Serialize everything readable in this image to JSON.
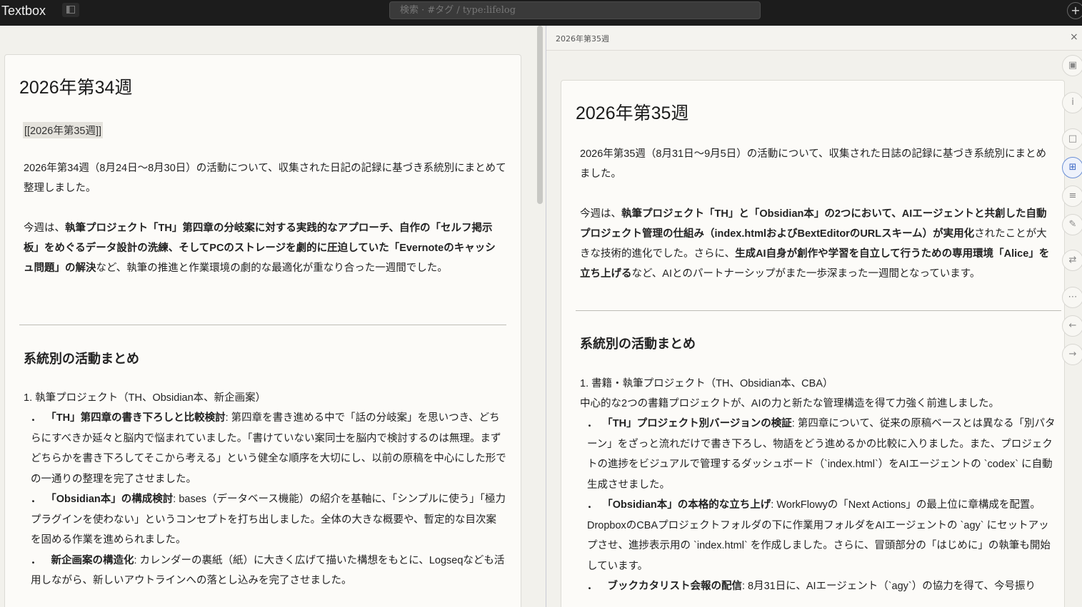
{
  "topbar": {
    "app_title": "Textbox",
    "search_placeholder": "検索 · #タグ / type:lifelog",
    "plus_label": "+"
  },
  "left": {
    "title": "2026年第34週",
    "link": "[[2026年第35週]]",
    "intro": "2026年第34週（8月24日〜8月30日）の活動について、収集された日記の記録に基づき系統別にまとめて整理しました。",
    "summary_prefix": "今週は、",
    "summary_bold": "執筆プロジェクト「TH」第四章の分岐案に対する実践的なアプローチ、自作の「セルフ掲示板」をめぐるデータ設計の洗練、そしてPCのストレージを劇的に圧迫していた「Evernoteのキャッシュ問題」の解決",
    "summary_suffix": "など、執筆の推進と作業環境の劇的な最適化が重なり合った一週間でした。",
    "section": "系統別の活動まとめ",
    "list_heading": "1. 執筆プロジェクト（TH、Obsidian本、新企画案）",
    "items": [
      {
        "bold": "「TH」第四章の書き下ろしと比較検討",
        "text": ": 第四章を書き進める中で「話の分岐案」を思いつき、どちらにすべきか延々と脳内で悩まれていました。「書けていない案同士を脳内で検討するのは無理。まずどちらかを書き下ろしてそこから考える」という健全な順序を大切にし、以前の原稿を中心にした形での一通りの整理を完了させました。"
      },
      {
        "bold": "「Obsidian本」の構成検討",
        "text": ": bases（データベース機能）の紹介を基軸に、「シンプルに使う」「極力プラグインを使わない」というコンセプトを打ち出しました。全体の大きな概要や、暫定的な目次案を固める作業を進められました。"
      },
      {
        "bold": "新企画案の構造化",
        "text": ": カレンダーの裏紙（紙）に大きく広げて描いた構想をもとに、Logseqなども活用しながら、新しいアウトラインへの落とし込みを完了させました。"
      }
    ]
  },
  "right": {
    "tab_label": "2026年第35週",
    "close_label": "×",
    "title": "2026年第35週",
    "intro": "2026年第35週（8月31日〜9月5日）の活動について、収集された日誌の記録に基づき系統別にまとめました。",
    "summary_prefix": "今週は、",
    "summary_bold1": "執筆プロジェクト「TH」と「Obsidian本」の2つにおいて、AIエージェントと共創した自動プロジェクト管理の仕組み（index.htmlおよびBextEditorのURLスキーム）が実用化",
    "summary_mid": "されたことが大きな技術的進化でした。さらに、",
    "summary_bold2": "生成AI自身が創作や学習を自立して行うための専用環境「Alice」を立ち上げる",
    "summary_suffix": "など、AIとのパートナーシップがまた一歩深まった一週間となっています。",
    "section": "系統別の活動まとめ",
    "list_heading": "1. 書籍・執筆プロジェクト（TH、Obsidian本、CBA）",
    "list_sub": "中心的な2つの書籍プロジェクトが、AIの力と新たな管理構造を得て力強く前進しました。",
    "items": [
      {
        "bold": "「TH」プロジェクト別バージョンの検証",
        "text": ": 第四章について、従来の原稿ベースとは異なる「別パターン」をざっと流れだけで書き下ろし、物語をどう進めるかの比較に入りました。また、プロジェクトの進捗をビジュアルで管理するダッシュボード（`index.html`）をAIエージェントの `codex` に自動生成させました。"
      },
      {
        "bold": "「Obsidian本」の本格的な立ち上げ",
        "text": ": WorkFlowyの「Next Actions」の最上位に章構成を配置。DropboxのCBAプロジェクトフォルダの下に作業用フォルダをAIエージェントの `agy` にセットアップさせ、進捗表示用の `index.html` を作成しました。さらに、冒頭部分の「はじめに」の執筆も開始しています。"
      },
      {
        "bold": "ブックカタリスト会報の配信",
        "text": ": 8月31日に、AIエージェント（`agy`）の協力を得て、今号振り"
      }
    ]
  },
  "tools": [
    "camera-icon",
    "info-icon",
    "layout-icon",
    "grid-icon",
    "list-icon",
    "pencil-icon",
    "swap-icon",
    "more-icon",
    "back-icon",
    "forward-icon"
  ]
}
